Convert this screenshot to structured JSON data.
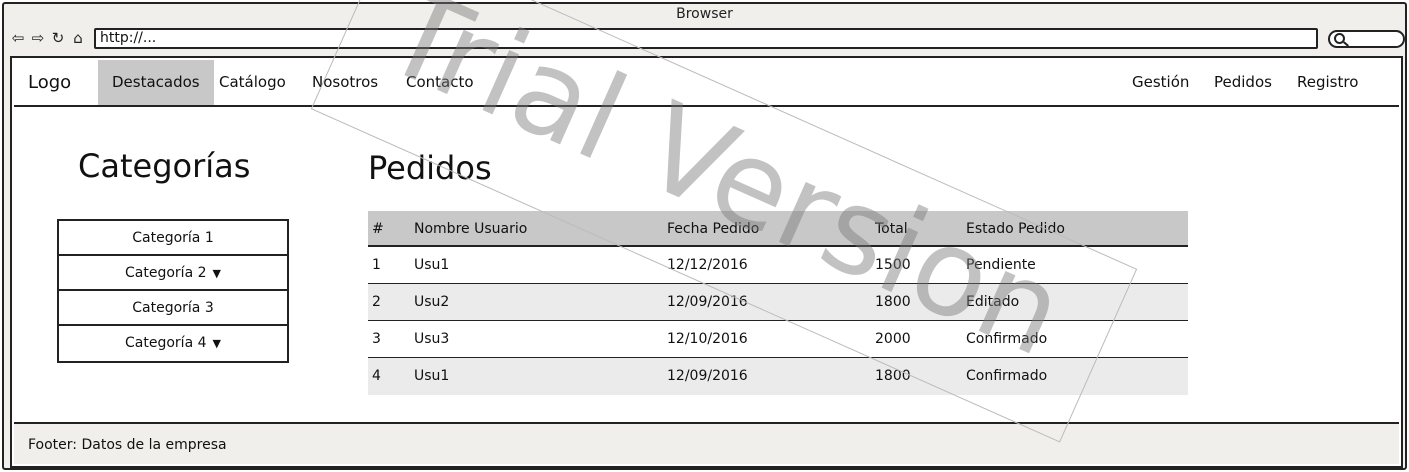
{
  "browser": {
    "title": "Browser",
    "url": "http://...",
    "nav_icons": [
      "back-icon",
      "forward-icon",
      "reload-icon",
      "home-icon"
    ]
  },
  "navbar": {
    "logo": "Logo",
    "left_items": [
      "Destacados",
      "Catálogo",
      "Nosotros",
      "Contacto"
    ],
    "right_items": [
      "Gestión",
      "Pedidos",
      "Registro"
    ],
    "active": "Destacados"
  },
  "sidebar": {
    "title": "Categorías",
    "items": [
      {
        "label": "Categoría 1",
        "dropdown": false
      },
      {
        "label": "Categoría 2",
        "dropdown": true
      },
      {
        "label": "Categoría 3",
        "dropdown": false
      },
      {
        "label": "Categoría 4",
        "dropdown": true
      }
    ]
  },
  "orders": {
    "title": "Pedidos",
    "columns": [
      "#",
      "Nombre Usuario",
      "Fecha Pedido",
      "Total",
      "Estado Pedido"
    ],
    "rows": [
      [
        "1",
        "Usu1",
        "12/12/2016",
        "1500",
        "Pendiente"
      ],
      [
        "2",
        "Usu2",
        "12/09/2016",
        "1800",
        "Editado"
      ],
      [
        "3",
        "Usu3",
        "12/10/2016",
        "2000",
        "Confirmado"
      ],
      [
        "4",
        "Usu1",
        "12/09/2016",
        "1800",
        "Confirmado"
      ]
    ]
  },
  "footer": {
    "text": "Footer: Datos de la empresa"
  },
  "watermark": "Trial Version",
  "colors": {
    "header_bg": "#c8c8c8",
    "alt_row_bg": "#ebebeb",
    "chrome_bg": "#f0efeb"
  }
}
